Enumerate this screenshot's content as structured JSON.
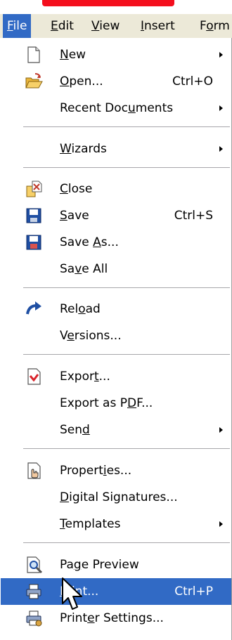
{
  "colors": {
    "highlight": "#316ac5",
    "menubar_bg": "#ece9d8",
    "separator": "#a7a6aa",
    "red_mark": "#f40e1d"
  },
  "menubar": {
    "items": [
      {
        "pre": "",
        "acc": "F",
        "post": "ile",
        "active": true
      },
      {
        "pre": "",
        "acc": "E",
        "post": "dit",
        "active": false
      },
      {
        "pre": "",
        "acc": "V",
        "post": "iew",
        "active": false
      },
      {
        "pre": "",
        "acc": "I",
        "post": "nsert",
        "active": false
      },
      {
        "pre": "F",
        "acc": "o",
        "post": "rm",
        "active": false
      }
    ]
  },
  "file_menu": {
    "items": [
      {
        "pre": "",
        "acc": "N",
        "post": "ew",
        "shortcut": "",
        "submenu": true,
        "icon": "new-document-icon"
      },
      {
        "pre": "",
        "acc": "O",
        "post": "pen...",
        "shortcut": "Ctrl+O",
        "submenu": false,
        "icon": "open-folder-icon"
      },
      {
        "pre": "Recent Doc",
        "acc": "u",
        "post": "ments",
        "shortcut": "",
        "submenu": true,
        "icon": ""
      },
      {
        "pre": "",
        "acc": "W",
        "post": "izards",
        "shortcut": "",
        "submenu": true,
        "icon": ""
      },
      {
        "pre": "",
        "acc": "C",
        "post": "lose",
        "shortcut": "",
        "submenu": false,
        "icon": "close-document-icon"
      },
      {
        "pre": "",
        "acc": "S",
        "post": "ave",
        "shortcut": "Ctrl+S",
        "submenu": false,
        "icon": "save-icon"
      },
      {
        "pre": "Save ",
        "acc": "A",
        "post": "s...",
        "shortcut": "",
        "submenu": false,
        "icon": "save-as-icon"
      },
      {
        "pre": "Sa",
        "acc": "v",
        "post": "e All",
        "shortcut": "",
        "submenu": false,
        "icon": ""
      },
      {
        "pre": "Rel",
        "acc": "o",
        "post": "ad",
        "shortcut": "",
        "submenu": false,
        "icon": "reload-icon"
      },
      {
        "pre": "V",
        "acc": "e",
        "post": "rsions...",
        "shortcut": "",
        "submenu": false,
        "icon": ""
      },
      {
        "pre": "Expor",
        "acc": "t",
        "post": "...",
        "shortcut": "",
        "submenu": false,
        "icon": "export-icon"
      },
      {
        "pre": "Export as P",
        "acc": "D",
        "post": "F...",
        "shortcut": "",
        "submenu": false,
        "icon": ""
      },
      {
        "pre": "Sen",
        "acc": "d",
        "post": "",
        "shortcut": "",
        "submenu": true,
        "icon": ""
      },
      {
        "pre": "Propert",
        "acc": "i",
        "post": "es...",
        "shortcut": "",
        "submenu": false,
        "icon": "properties-icon"
      },
      {
        "pre": "",
        "acc": "D",
        "post": "igital Signatures...",
        "shortcut": "",
        "submenu": false,
        "icon": ""
      },
      {
        "pre": "",
        "acc": "T",
        "post": "emplates",
        "shortcut": "",
        "submenu": true,
        "icon": ""
      },
      {
        "pre": "Pa",
        "acc": "g",
        "post": "e Preview",
        "shortcut": "",
        "submenu": false,
        "icon": "page-preview-icon"
      },
      {
        "pre": "",
        "acc": "P",
        "post": "rint...",
        "shortcut": "Ctrl+P",
        "submenu": false,
        "icon": "print-icon",
        "highlighted": true
      },
      {
        "pre": "Print",
        "acc": "e",
        "post": "r Settings...",
        "shortcut": "",
        "submenu": false,
        "icon": "printer-settings-icon"
      }
    ]
  }
}
